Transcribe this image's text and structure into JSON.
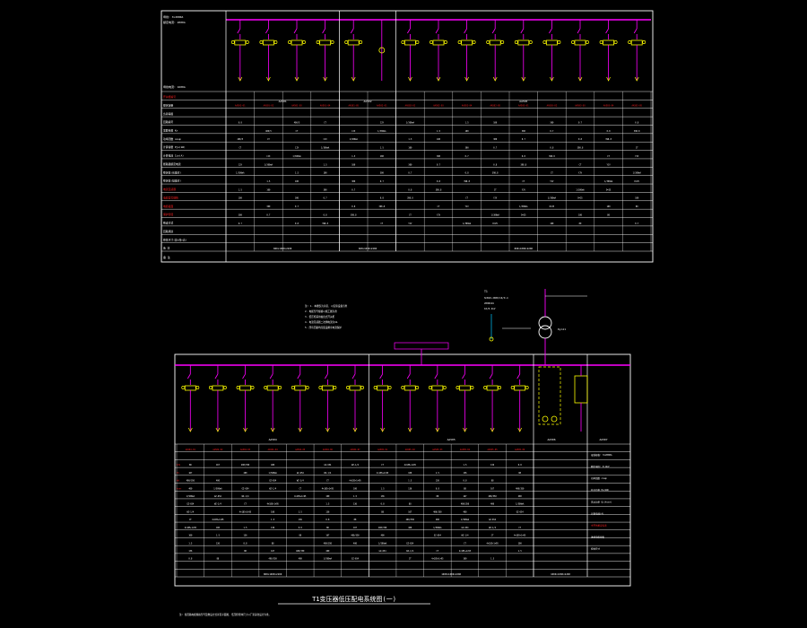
{
  "colors": {
    "background": "#000000",
    "frame": "#ffffff",
    "busbar": "#ff00ff",
    "breaker": "#ffff00",
    "feeder": "#ff00ff",
    "highlight_text": "#ff2020",
    "cyan_line": "#00c8ff"
  },
  "top_sheet": {
    "cabinets": [
      "AA501",
      "AA502",
      "AA503"
    ],
    "header_left": [
      "母线: 3×2000A",
      "额定电流: 2000A"
    ],
    "left_rows": [
      "开关柜编号",
      "额定容量",
      "负荷等级",
      "回路编号",
      "需要系数 Kx",
      "功率因数 cosφ",
      "计算容量 Pjs(kW)",
      "计算电流 Ijs(A)",
      "断路器额定电流",
      "整定值(长延时)",
      "整定值(短延时)",
      "电流互感器",
      "电缆型号规格",
      "电缆截面",
      "保护管径",
      "敷设方式",
      "回路用途",
      "柜体尺寸(宽×深×高)",
      "备 注"
    ],
    "sizes": [
      "800×1000×2200",
      "600×1000×2200",
      "800×1000×2200"
    ],
    "remarks": [
      "备 注"
    ]
  },
  "bottom_sheet": {
    "title": "T1变压器低压配电系统图(一)",
    "cabinets": [
      "AA504",
      "AA505",
      "AA506",
      "AA507"
    ],
    "notes": [
      "注: 1. 本图仅为示意, 以实际设备为准",
      "2. 电缆型号规格以施工图为准",
      "3. 低压柜采用抽出式开关柜",
      "4. 电流互感器二次侧电流为5A",
      "5. 所有回路均应装设剩余电流保护"
    ],
    "transformer": {
      "label": "T1",
      "model": "SCB10-2000/10/0.4",
      "rating": "2000kVA",
      "winding": "Dyn11",
      "voltage": "10/0.4kV"
    },
    "right_panel": [
      "母线规格: 3×2000A",
      "额定电压: 0.4kV",
      "功率因数 cosφ",
      "有功功率 Pe(kW)",
      "无功功率 Qc(kvar)",
      "计算电流(A)",
      "主开关额定电流",
      "进线电缆规格",
      "柜体尺寸"
    ],
    "sizes": [
      "800×1000×2200",
      "1000×1000×2200",
      "1000×1000×2200"
    ]
  }
}
